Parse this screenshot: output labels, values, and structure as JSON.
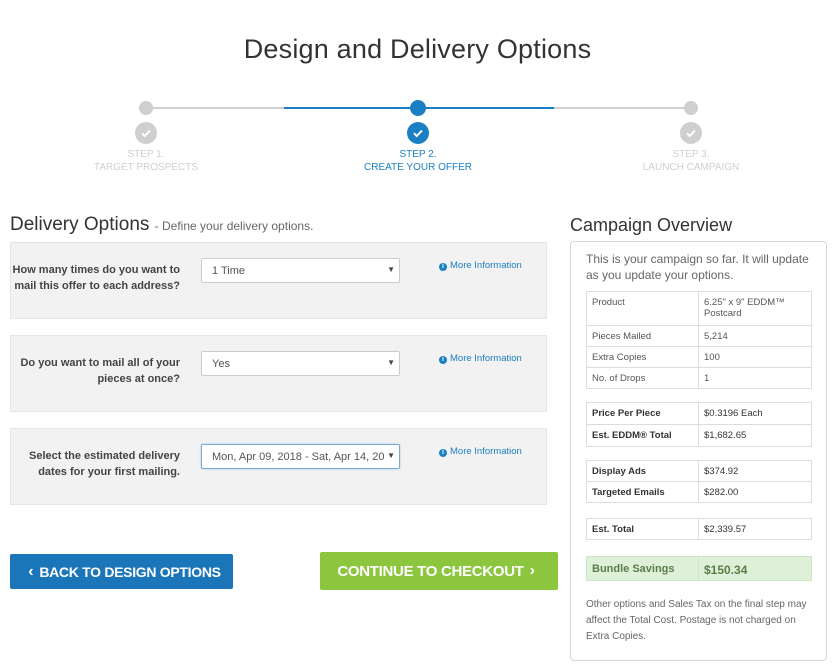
{
  "page": {
    "title": "Design and Delivery Options"
  },
  "stepper": {
    "steps": [
      {
        "number": "STEP 1.",
        "label": "TARGET PROSPECTS",
        "state": "complete"
      },
      {
        "number": "STEP 2.",
        "label": "CREATE YOUR OFFER",
        "state": "active"
      },
      {
        "number": "STEP 3.",
        "label": "LAUNCH CAMPAIGN",
        "state": "upcoming"
      }
    ],
    "colors": {
      "active": "#1b7fc4",
      "inactive": "#cfcfcf"
    }
  },
  "delivery": {
    "title": "Delivery Options",
    "subtitle": "- Define your delivery options.",
    "more_info": "More Information",
    "questions": [
      {
        "label_line1": "How many times do you want to",
        "label_line2": "mail this offer to each address?",
        "value": "1 Time"
      },
      {
        "label_line1": "Do you want to mail all of your",
        "label_line2": "pieces at once?",
        "value": "Yes"
      },
      {
        "label_line1": "Select the estimated delivery",
        "label_line2": "dates for your first mailing.",
        "value": "Mon, Apr 09, 2018 - Sat, Apr 14, 20"
      }
    ]
  },
  "buttons": {
    "back": "BACK TO DESIGN OPTIONS",
    "continue": "CONTINUE TO CHECKOUT",
    "back_color": "#1a76b8",
    "continue_color": "#8cc63f"
  },
  "overview": {
    "title": "Campaign Overview",
    "intro": "This is your campaign so far. It will update as you update your options.",
    "details": [
      {
        "label": "Product",
        "value": "6.25\" x 9\" EDDM™ Postcard"
      },
      {
        "label": "Pieces Mailed",
        "value": "5,214"
      },
      {
        "label": "Extra Copies",
        "value": "100"
      },
      {
        "label": "No. of Drops",
        "value": "1"
      }
    ],
    "pricing": [
      {
        "label": "Price Per Piece",
        "value": "$0.3196 Each"
      },
      {
        "label": "Est. EDDM® Total",
        "value": "$1,682.65"
      }
    ],
    "addons": [
      {
        "label": "Display Ads",
        "value": "$374.92"
      },
      {
        "label": "Targeted Emails",
        "value": "$282.00"
      }
    ],
    "total": {
      "label": "Est. Total",
      "value": "$2,339.57"
    },
    "savings": {
      "label": "Bundle Savings",
      "value": "$150.34"
    },
    "note": "Other options and Sales Tax on the final step may affect the Total Cost. Postage is not charged on Extra Copies."
  }
}
